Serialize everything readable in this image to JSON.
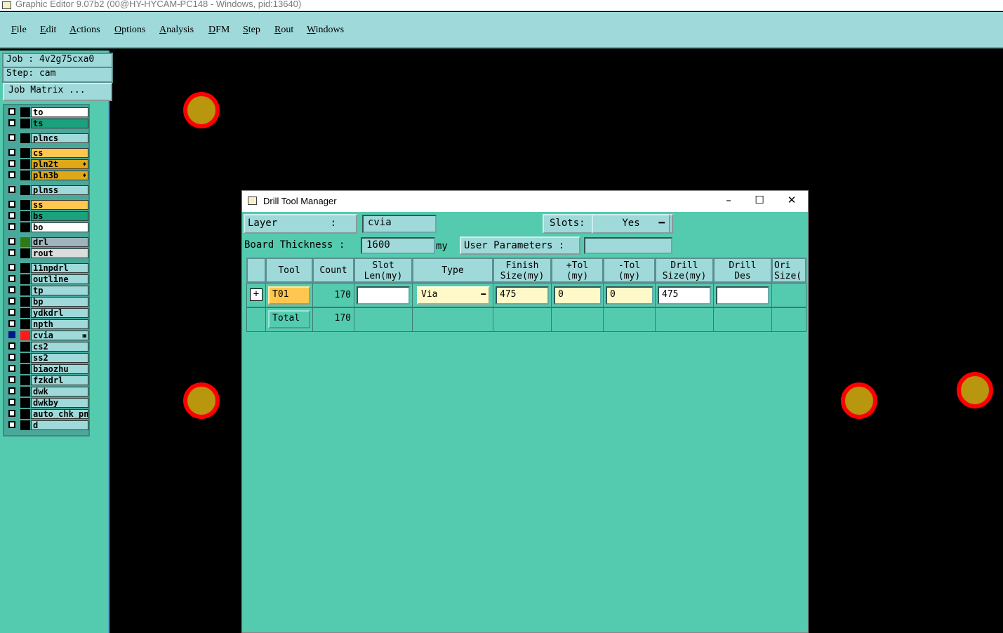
{
  "window": {
    "title": "Graphic Editor 9.07b2 (00@HY-HYCAM-PC148 - Windows, pid:13640)"
  },
  "menu": [
    "File",
    "Edit",
    "Actions",
    "Options",
    "Analysis",
    "DFM",
    "Step",
    "Rout",
    "Windows"
  ],
  "left": {
    "job": "Job : 4v2g75cxa0",
    "step": "Step: cam",
    "job_matrix": "Job Matrix ..."
  },
  "layers": [
    {
      "name": "to",
      "color": "#ffffff",
      "swatch": "#000000"
    },
    {
      "name": "ts",
      "color": "#1aa27c",
      "swatch": "#000000"
    },
    {
      "name": "plncs",
      "color": "#9fd9d9",
      "swatch": "#000000"
    },
    {
      "name": "cs",
      "color": "#ffc74f",
      "swatch": "#000000"
    },
    {
      "name": "pln2t",
      "color": "#e0a817",
      "swatch": "#000000"
    },
    {
      "name": "pln3b",
      "color": "#e0a817",
      "swatch": "#000000"
    },
    {
      "name": "plnss",
      "color": "#9fd9d9",
      "swatch": "#000000"
    },
    {
      "name": "ss",
      "color": "#ffc74f",
      "swatch": "#000000"
    },
    {
      "name": "bs",
      "color": "#1aa27c",
      "swatch": "#000000"
    },
    {
      "name": "bo",
      "color": "#ffffff",
      "swatch": "#000000"
    },
    {
      "name": "drl",
      "color": "#9fb4bc",
      "swatch": "#2f7a14"
    },
    {
      "name": "rout",
      "color": "#dcdcdc",
      "swatch": "#000000"
    },
    {
      "name": "11npdrl",
      "color": "#9fd9d9",
      "swatch": "#000000"
    },
    {
      "name": "outline",
      "color": "#9fd9d9",
      "swatch": "#000000"
    },
    {
      "name": "tp",
      "color": "#9fd9d9",
      "swatch": "#000000"
    },
    {
      "name": "bp",
      "color": "#9fd9d9",
      "swatch": "#000000"
    },
    {
      "name": "ydkdrl",
      "color": "#9fd9d9",
      "swatch": "#000000"
    },
    {
      "name": "npth",
      "color": "#9fd9d9",
      "swatch": "#000000"
    },
    {
      "name": "cvia",
      "color": "#9fd9d9",
      "swatch": "#ff1a1a"
    },
    {
      "name": "cs2",
      "color": "#9fd9d9",
      "swatch": "#000000"
    },
    {
      "name": "ss2",
      "color": "#9fd9d9",
      "swatch": "#000000"
    },
    {
      "name": "biaozhu",
      "color": "#9fd9d9",
      "swatch": "#000000"
    },
    {
      "name": "fzkdrl",
      "color": "#9fd9d9",
      "swatch": "#000000"
    },
    {
      "name": "dwk",
      "color": "#9fd9d9",
      "swatch": "#000000"
    },
    {
      "name": "dwkby",
      "color": "#9fd9d9",
      "swatch": "#000000"
    },
    {
      "name": "auto_chk_pnl",
      "color": "#9fd9d9",
      "swatch": "#000000"
    },
    {
      "name": "d",
      "color": "#9fd9d9",
      "swatch": "#000000"
    }
  ],
  "dialog": {
    "title": "Drill Tool Manager",
    "layer_label": "Layer",
    "layer_colon": ":",
    "layer_value": "cvia",
    "slots_label": "Slots:",
    "slots_value": "Yes",
    "board_thickness_label": "Board Thickness :",
    "board_thickness_value": "1600",
    "board_thickness_unit": "my",
    "user_params_label": "User Parameters :",
    "user_params_value": "",
    "columns": [
      "Tool",
      "Count",
      "Slot\nLen(my)",
      "Type",
      "Finish\nSize(my)",
      "+Tol\n(my)",
      "-Tol\n(my)",
      "Drill\nSize(my)",
      "Drill\nDes",
      "Ori\nSize("
    ],
    "rows": [
      {
        "tool": "T01",
        "count": "170",
        "slot_len": "",
        "type": "Via",
        "finish": "475",
        "ptol": "0",
        "mtol": "0",
        "drill": "475",
        "des": ""
      }
    ],
    "total": {
      "label": "Total",
      "count": "170"
    }
  }
}
